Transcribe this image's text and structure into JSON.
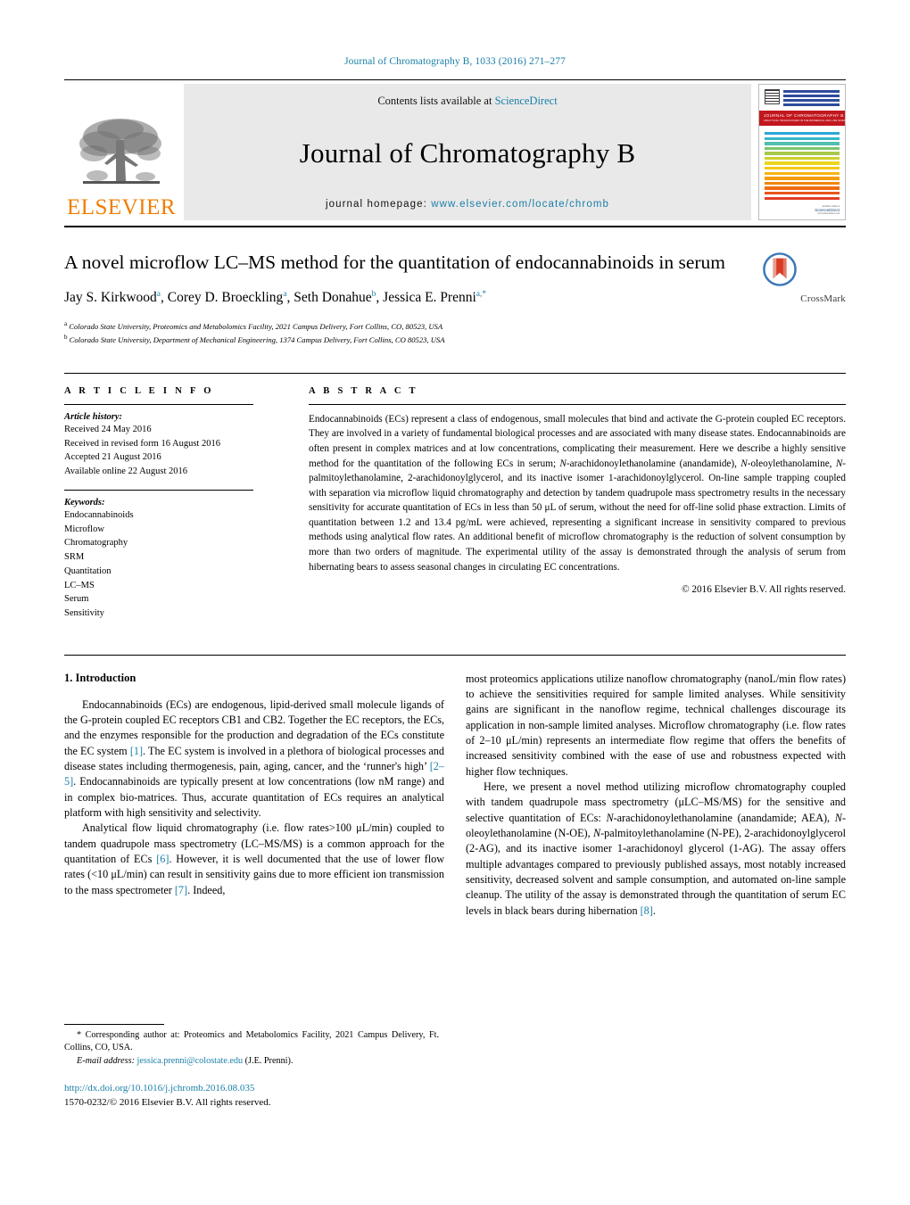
{
  "running_head": "Journal of Chromatography B, 1033 (2016) 271–277",
  "header": {
    "publisher_name": "ELSEVIER",
    "contents_prefix": "Contents lists available at ",
    "contents_link": "ScienceDirect",
    "journal_title": "Journal of Chromatography B",
    "homepage_prefix": "journal homepage: ",
    "homepage_url": "www.elsevier.com/locate/chromb"
  },
  "cover": {
    "band_title": "JOURNAL OF CHROMATOGRAPHY B",
    "band_subtitle": "ANALYTICAL TECHNOLOGIES IN THE BIOMEDICAL AND LIFE SCIENCES",
    "footer_brand": "ScienceDirect",
    "footer_small": "Available online at",
    "footer_tiny": "www.sciencedirect.com"
  },
  "article": {
    "title": "A novel microflow LC–MS method for the quantitation of endocannabinoids in serum",
    "crossmark_label": "CrossMark",
    "authors": [
      {
        "name": "Jay S. Kirkwood",
        "sup": "a",
        "sep": ", "
      },
      {
        "name": "Corey D. Broeckling",
        "sup": "a",
        "sep": ", "
      },
      {
        "name": "Seth Donahue",
        "sup": "b",
        "sep": ", "
      },
      {
        "name": "Jessica E. Prenni",
        "sup": "a,*",
        "sep": ""
      }
    ],
    "affiliations": [
      {
        "marker": "a",
        "text": "Colorado State University, Proteomics and Metabolomics Facility, 2021 Campus Delivery, Fort Collins, CO, 80523, USA"
      },
      {
        "marker": "b",
        "text": "Colorado State University, Department of Mechanical Engineering, 1374 Campus Delivery, Fort Collins, CO 80523, USA"
      }
    ]
  },
  "article_info": {
    "heading": "A R T I C L E   I N F O",
    "history_title": "Article history:",
    "history": [
      "Received 24 May 2016",
      "Received in revised form 16 August 2016",
      "Accepted 21 August 2016",
      "Available online 22 August 2016"
    ],
    "keywords_title": "Keywords:",
    "keywords": [
      "Endocannabinoids",
      "Microflow",
      "Chromatography",
      "SRM",
      "Quantitation",
      "LC–MS",
      "Serum",
      "Sensitivity"
    ]
  },
  "abstract": {
    "heading": "A B S T R A C T",
    "text_parts": [
      {
        "t": "Endocannabinoids (ECs) represent a class of endogenous, small molecules that bind and activate the G-protein coupled EC receptors. They are involved in a variety of fundamental biological processes and are associated with many disease states. Endocannabinoids are often present in complex matrices and at low concentrations, complicating their measurement. Here we describe a highly sensitive method for the quantitation of the following ECs in serum; "
      },
      {
        "t": "N",
        "i": true
      },
      {
        "t": "-arachidonoylethanolamine (anandamide), "
      },
      {
        "t": "N",
        "i": true
      },
      {
        "t": "-oleoylethanolamine, "
      },
      {
        "t": "N",
        "i": true
      },
      {
        "t": "-palmitoylethanolamine, 2-arachidonoylglycerol, and its inactive isomer 1-arachidonoylglycerol. On-line sample trapping coupled with separation via microflow liquid chromatography and detection by tandem quadrupole mass spectrometry results in the necessary sensitivity for accurate quantitation of ECs in less than 50 μL of serum, without the need for off-line solid phase extraction. Limits of quantitation between 1.2 and 13.4 pg/mL were achieved, representing a significant increase in sensitivity compared to previous methods using analytical flow rates. An additional benefit of microflow chromatography is the reduction of solvent consumption by more than two orders of magnitude. The experimental utility of the assay is demonstrated through the analysis of serum from hibernating bears to assess seasonal changes in circulating EC concentrations."
      }
    ],
    "copyright": "© 2016 Elsevier B.V. All rights reserved."
  },
  "introduction": {
    "section_number_title": "1.  Introduction",
    "left_paragraphs": [
      [
        {
          "t": "Endocannabinoids (ECs) are endogenous, lipid-derived small molecule ligands of the G-protein coupled EC receptors CB1 and CB2. Together the EC receptors, the ECs, and the enzymes responsible for the production and degradation of the ECs constitute the EC system "
        },
        {
          "t": "[1]",
          "ref": true
        },
        {
          "t": ". The EC system is involved in a plethora of biological processes and disease states including thermogenesis, pain, aging, cancer, and the ‘runner's high’ "
        },
        {
          "t": "[2–5]",
          "ref": true
        },
        {
          "t": ". Endocannabinoids are typically present at low concentrations (low nM range) and in complex bio-matrices. Thus, accurate quantitation of ECs requires an analytical platform with high sensitivity and selectivity."
        }
      ],
      [
        {
          "t": "Analytical flow liquid chromatography (i.e. flow rates>100 μL/min) coupled to tandem quadrupole mass spectrometry (LC–MS/MS) is a common approach for the quantitation of ECs "
        },
        {
          "t": "[6]",
          "ref": true
        },
        {
          "t": ". However, it is well documented that the use of lower flow rates (<10 μL/min) can result in sensitivity gains due to more efficient ion transmission to the mass spectrometer "
        },
        {
          "t": "[7]",
          "ref": true
        },
        {
          "t": ". Indeed,"
        }
      ]
    ],
    "right_paragraphs": [
      [
        {
          "t": "most proteomics applications utilize nanoflow chromatography (nanoL/min flow rates) to achieve the sensitivities required for sample limited analyses. While sensitivity gains are significant in the nanoflow regime, technical challenges discourage its application in non-sample limited analyses. Microflow chromatography (i.e. flow rates of 2–10 μL/min) represents an intermediate flow regime that offers the benefits of increased sensitivity combined with the ease of use and robustness expected with higher flow techniques."
        }
      ],
      [
        {
          "t": "Here, we present a novel method utilizing microflow chromatography coupled with tandem quadrupole mass spectrometry (μLC–MS/MS) for the sensitive and selective quantitation of ECs: "
        },
        {
          "t": "N",
          "i": true
        },
        {
          "t": "-arachidonoylethanolamine (anandamide; AEA), "
        },
        {
          "t": "N",
          "i": true
        },
        {
          "t": "-oleoylethanolamine (N-OE), "
        },
        {
          "t": "N",
          "i": true
        },
        {
          "t": "-palmitoylethanolamine (N-PE), 2-arachidonoylglycerol (2-AG), and its inactive isomer 1-arachidonoyl glycerol (1-AG). The assay offers multiple advantages compared to previously published assays, most notably increased sensitivity, decreased solvent and sample consumption, and automated on-line sample cleanup. The utility of the assay is demonstrated through the quantitation of serum EC levels in black bears during hibernation "
        },
        {
          "t": "[8]",
          "ref": true
        },
        {
          "t": "."
        }
      ]
    ],
    "right_first_is_continuation": true
  },
  "footnotes": {
    "corresponding": "*  Corresponding author at: Proteomics and Metabolomics Facility, 2021 Campus Delivery, Ft. Collins, CO, USA.",
    "email_label": "E-mail address:",
    "email": "jessica.prenni@colostate.edu",
    "email_suffix": " (J.E. Prenni).",
    "doi": "http://dx.doi.org/10.1016/j.jchromb.2016.08.035",
    "issn": "1570-0232/© 2016 Elsevier B.V. All rights reserved."
  },
  "colors": {
    "link": "#1a7fa8",
    "elsevier_orange": "#f07d00",
    "cover_red": "#c3171e"
  }
}
